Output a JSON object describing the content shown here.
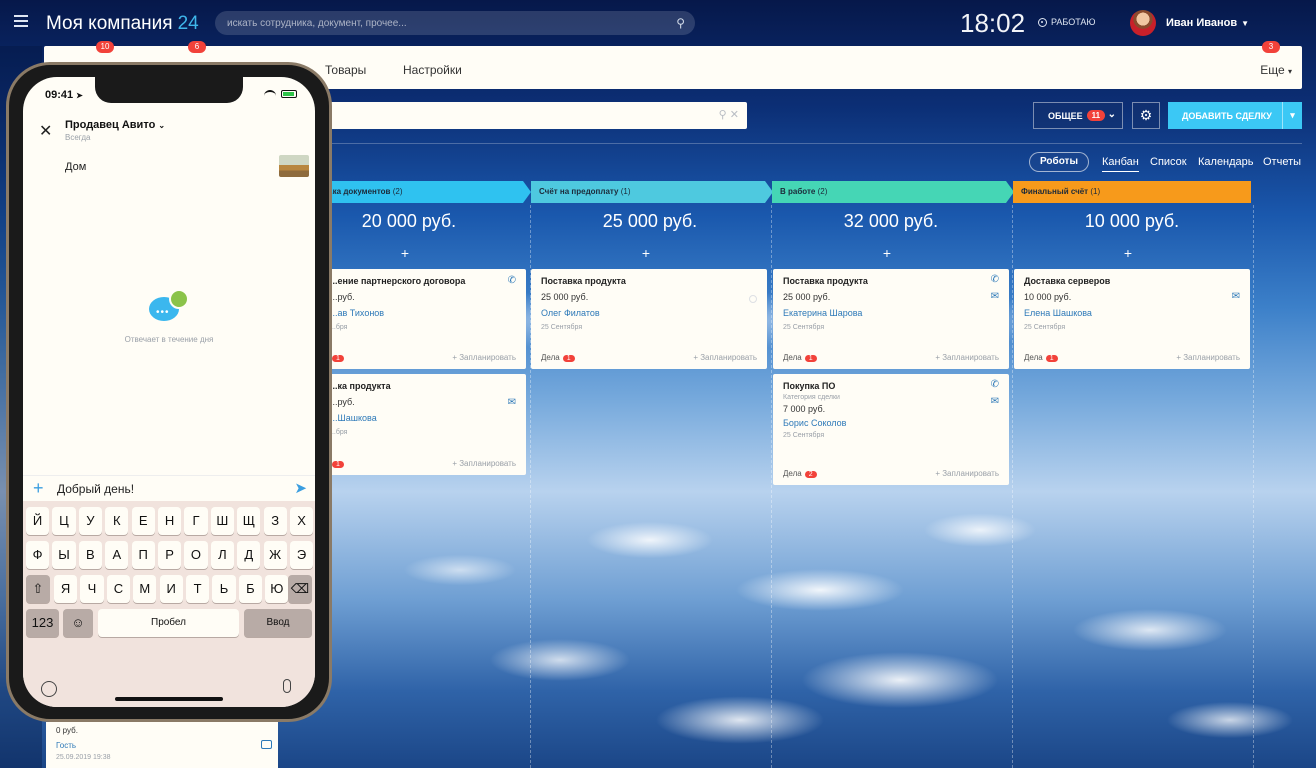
{
  "header": {
    "brand": "Моя компания",
    "brand_num": "24",
    "search_placeholder": "искать сотрудника, документ, прочее...",
    "clock": "18:02",
    "status": "РАБОТАЮ",
    "user": "Иван Иванов"
  },
  "menu": {
    "badges": [
      "10",
      "6"
    ],
    "items": [
      "Товары",
      "Настройки"
    ],
    "more": "Еще",
    "more_badge": "3"
  },
  "toolbar": {
    "general": "ОБЩЕЕ",
    "general_count": "11",
    "add_deal": "ДОБАВИТЬ СДЕЛКУ"
  },
  "views": {
    "robots": "Роботы",
    "tabs": [
      "Канбан",
      "Список",
      "Календарь",
      "Отчеты"
    ]
  },
  "kanban": {
    "stages": [
      {
        "name": "...ка документов",
        "count": "(2)",
        "sum": "20 000 руб.",
        "color": "#2fc2f0"
      },
      {
        "name": "Счёт на предоплату",
        "count": "(1)",
        "sum": "25 000 руб.",
        "color": "#4ec9df"
      },
      {
        "name": "В работе",
        "count": "(2)",
        "sum": "32 000 руб.",
        "color": "#45d6b5"
      },
      {
        "name": "Финальный счёт",
        "count": "(1)",
        "sum": "10 000 руб.",
        "color": "#f79a1b"
      }
    ],
    "cards": [
      {
        "title": "...ение партнерского договора",
        "price": "...руб.",
        "contact": "...ав Тихонов",
        "date": "...бря",
        "deals": "Дела",
        "deals_count": "1",
        "plan": "+ Запланировать"
      },
      {
        "title": "...ка продукта",
        "price": "...руб.",
        "contact": "...Шашкова",
        "date": "...бря",
        "deals": "Дела",
        "deals_count": "1",
        "plan": "+ Запланировать"
      },
      {
        "title": "Поставка продукта",
        "price": "25 000 руб.",
        "contact": "Олег Филатов",
        "date": "25 Сентября",
        "deals": "Дела",
        "deals_count": "1",
        "plan": "+ Запланировать"
      },
      {
        "title": "Поставка продукта",
        "price": "25 000 руб.",
        "contact": "Екатерина Шарова",
        "date": "25 Сентября",
        "deals": "Дела",
        "deals_count": "1",
        "plan": "+ Запланировать"
      },
      {
        "title": "Покупка ПО",
        "sub": "Категория сделки",
        "price": "7 000 руб.",
        "contact": "Борис Соколов",
        "date": "25 Сентября",
        "deals": "Дела",
        "deals_count": "2",
        "plan": "+ Запланировать"
      },
      {
        "title": "Доставка серверов",
        "price": "10 000 руб.",
        "contact": "Елена Шашкова",
        "date": "25 Сентября",
        "deals": "Дела",
        "deals_count": "1",
        "plan": "+ Запланировать"
      }
    ],
    "bottom_card": {
      "price": "0 руб.",
      "contact": "Гость",
      "date": "25.09.2019 19:38"
    }
  },
  "phone": {
    "time": "09:41",
    "chat_title": "Продавец Авито",
    "chat_sub": "Всегда",
    "item": "Дом",
    "answer_note": "Отвечает в течение дня",
    "message": "Добрый день!",
    "keyboard": {
      "row1": [
        "Й",
        "Ц",
        "У",
        "К",
        "Е",
        "Н",
        "Г",
        "Ш",
        "Щ",
        "З",
        "Х"
      ],
      "row2": [
        "Ф",
        "Ы",
        "В",
        "А",
        "П",
        "Р",
        "О",
        "Л",
        "Д",
        "Ж",
        "Э"
      ],
      "row3": [
        "Я",
        "Ч",
        "С",
        "М",
        "И",
        "Т",
        "Ь",
        "Б",
        "Ю"
      ],
      "num": "123",
      "space": "Пробел",
      "enter": "Ввод"
    }
  }
}
